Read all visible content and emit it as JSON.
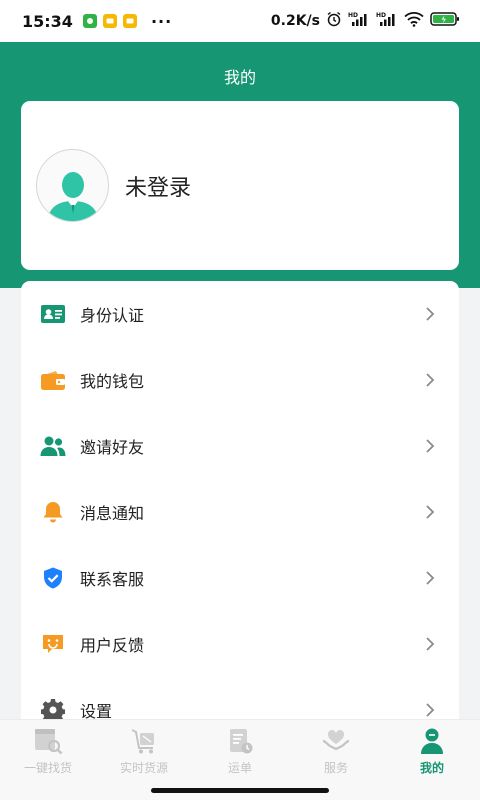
{
  "status_bar": {
    "time": "15:34",
    "dots": "···",
    "net_speed": "0.2K/s",
    "signal_label": "HD"
  },
  "header": {
    "title": "我的"
  },
  "profile": {
    "login_label": "未登录"
  },
  "menu": [
    {
      "key": "identity",
      "label": "身份认证",
      "icon": "id-card-icon",
      "color": "#179673"
    },
    {
      "key": "wallet",
      "label": "我的钱包",
      "icon": "wallet-icon",
      "color": "#f59a23"
    },
    {
      "key": "invite",
      "label": "邀请好友",
      "icon": "users-icon",
      "color": "#179673"
    },
    {
      "key": "notify",
      "label": "消息通知",
      "icon": "bell-icon",
      "color": "#f59a23"
    },
    {
      "key": "service",
      "label": "联系客服",
      "icon": "shield-check-icon",
      "color": "#1e80ff"
    },
    {
      "key": "feedback",
      "label": "用户反馈",
      "icon": "feedback-icon",
      "color": "#f59a23"
    },
    {
      "key": "settings",
      "label": "设置",
      "icon": "gear-icon",
      "color": "#555555"
    }
  ],
  "tabs": [
    {
      "label": "一键找货",
      "icon": "search-box-icon",
      "active": false
    },
    {
      "label": "实时货源",
      "icon": "cart-icon",
      "active": false
    },
    {
      "label": "运单",
      "icon": "waybill-icon",
      "active": false
    },
    {
      "label": "服务",
      "icon": "heart-hand-icon",
      "active": false
    },
    {
      "label": "我的",
      "icon": "person-icon",
      "active": true
    }
  ],
  "colors": {
    "brand": "#179673",
    "inactive": "#c4c4c4"
  }
}
